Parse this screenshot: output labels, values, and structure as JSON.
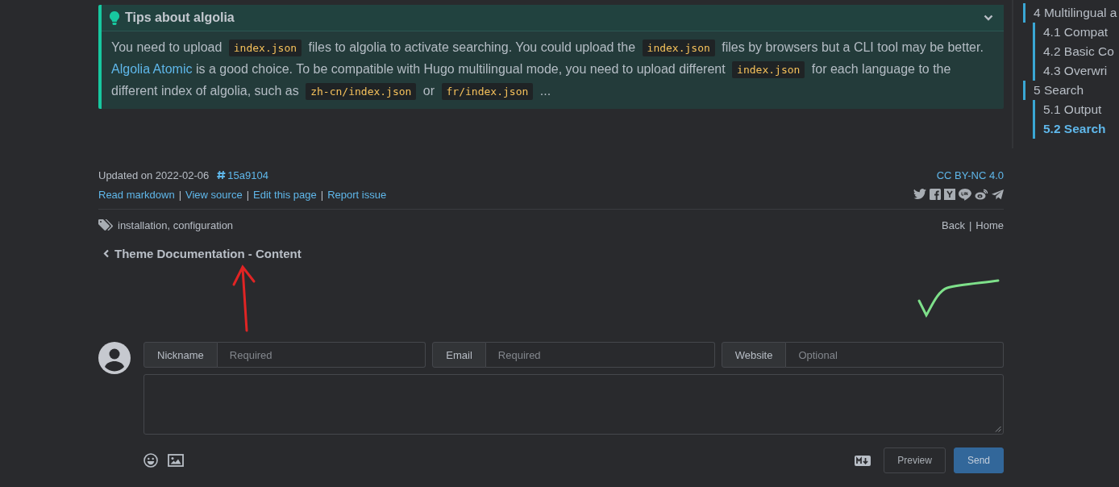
{
  "admonition": {
    "title": "Tips about algolia",
    "expanded": true,
    "body": [
      {
        "kind": "text",
        "text": "You need to upload "
      },
      {
        "kind": "code",
        "text": "index.json"
      },
      {
        "kind": "text",
        "text": " files to algolia to activate searching. You could upload the "
      },
      {
        "kind": "code",
        "text": "index.json"
      },
      {
        "kind": "text",
        "text": " files by browsers but a CLI tool may be better. "
      },
      {
        "kind": "link",
        "text": "Algolia Atomic"
      },
      {
        "kind": "text",
        "text": " is a good choice. To be compatible with Hugo multilingual mode, you need to upload different "
      },
      {
        "kind": "code",
        "text": "index.json"
      },
      {
        "kind": "text",
        "text": " for each language to the different index of algolia, such as "
      },
      {
        "kind": "code",
        "text": "zh-cn/index.json"
      },
      {
        "kind": "text",
        "text": " or "
      },
      {
        "kind": "code",
        "text": "fr/index.json"
      },
      {
        "kind": "text",
        "text": " ..."
      }
    ]
  },
  "toc": [
    {
      "label": "4 Multilingual a",
      "selected": false,
      "children": [
        {
          "label": "4.1 Compat",
          "selected": false
        },
        {
          "label": "4.2 Basic Co",
          "selected": false
        },
        {
          "label": "4.3 Overwri",
          "selected": false
        }
      ]
    },
    {
      "label": "5 Search",
      "selected": false,
      "children": [
        {
          "label": "5.1 Output",
          "selected": false
        },
        {
          "label": "5.2 Search",
          "selected": true
        }
      ]
    }
  ],
  "post_info": {
    "updated": "Updated on 2022-02-06",
    "commit": "15a9104",
    "license": "CC BY-NC 4.0",
    "separator": "|",
    "links": [
      "Read markdown",
      "View source",
      "Edit this page",
      "Report issue"
    ],
    "tags": "installation, configuration",
    "nav": [
      "Back",
      "Home"
    ]
  },
  "previous_post": "Theme Documentation - Content",
  "comment_form": {
    "fields": [
      {
        "label": "Nickname",
        "placeholder": "Required"
      },
      {
        "label": "Email",
        "placeholder": "Required"
      },
      {
        "label": "Website",
        "placeholder": "Optional"
      }
    ],
    "buttons": [
      {
        "label": "Preview",
        "kind": "secondary"
      },
      {
        "label": "Send",
        "kind": "primary"
      }
    ]
  }
}
